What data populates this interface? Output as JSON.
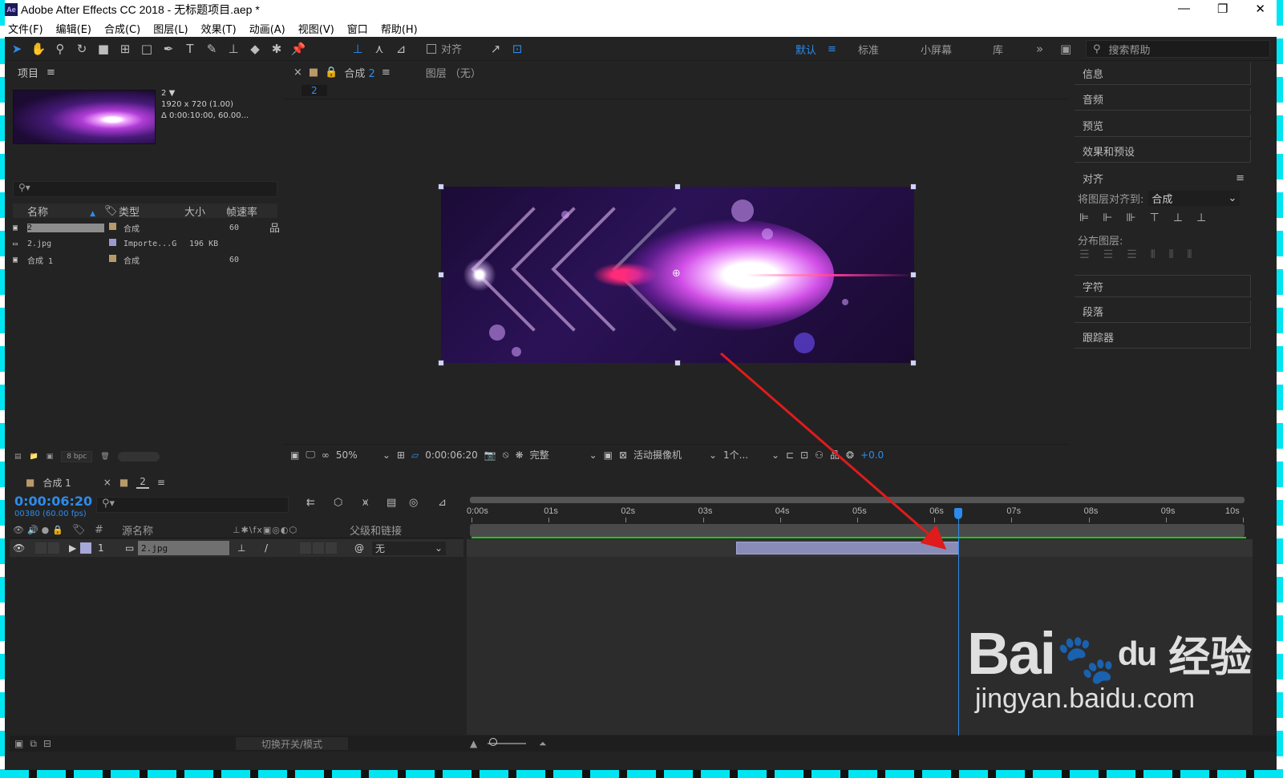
{
  "titlebar": {
    "title": "Adobe After Effects CC 2018 - 无标题项目.aep *",
    "icon": "Ae"
  },
  "menu": [
    "文件(F)",
    "编辑(E)",
    "合成(C)",
    "图层(L)",
    "效果(T)",
    "动画(A)",
    "视图(V)",
    "窗口",
    "帮助(H)"
  ],
  "toolbar": {
    "align_label": "对齐",
    "workspaces": [
      "默认",
      "标准",
      "小屏幕",
      "库"
    ],
    "active_workspace": "默认",
    "search_placeholder": "搜索帮助"
  },
  "project": {
    "tab": "项目",
    "selected": {
      "name": "2",
      "dims": "1920 x 720 (1.00)",
      "duration": "Δ 0:00:10:00, 60.00..."
    },
    "columns": [
      "名称",
      "类型",
      "大小",
      "帧速率"
    ],
    "items": [
      {
        "name": "2",
        "type": "合成",
        "size": "",
        "fps": "60",
        "color": "#b89a6a",
        "icon": "composition-icon"
      },
      {
        "name": "2.jpg",
        "type": "Importe...G",
        "size": "196 KB",
        "fps": "",
        "color": "#9a9ad0",
        "icon": "image-file-icon"
      },
      {
        "name": "合成 1",
        "type": "合成",
        "size": "",
        "fps": "60",
        "color": "#b89a6a",
        "icon": "composition-icon"
      }
    ],
    "bpc": "8 bpc"
  },
  "composition": {
    "tab_prefix": "合成",
    "tab_name": "2",
    "layer_tab": "图层 （无）",
    "breadcrumb": "2",
    "zoom": "50%",
    "timecode": "0:00:06:20",
    "resolution": "完整",
    "camera": "活动摄像机",
    "views": "1个...",
    "exposure": "+0.0"
  },
  "right_panels": {
    "items": [
      "信息",
      "音频",
      "预览",
      "效果和预设"
    ],
    "align_title": "对齐",
    "align_to_label": "将图层对齐到:",
    "align_to_value": "合成",
    "distribute_label": "分布图层:",
    "lower": [
      "字符",
      "段落",
      "跟踪器"
    ]
  },
  "timeline": {
    "tabs": [
      {
        "name": "合成 1",
        "active": false
      },
      {
        "name": "2",
        "active": true
      }
    ],
    "timecode": "0:00:06:20",
    "frames": "00380 (60.00 fps)",
    "columns": {
      "num": "#",
      "source": "源名称",
      "parent": "父级和链接"
    },
    "layer": {
      "index": "1",
      "name": "2.jpg",
      "parent": "无",
      "color": "#a7a7d8"
    },
    "ticks": [
      "0:00s",
      "01s",
      "02s",
      "03s",
      "04s",
      "05s",
      "06s",
      "07s",
      "08s",
      "09s",
      "10s"
    ],
    "footer_mode": "切换开关/模式"
  },
  "watermark": {
    "brand_a": "Bai",
    "brand_b": "du",
    "cn": "经验",
    "url": "jingyan.baidu.com"
  },
  "colors": {
    "accent": "#2d8ceb",
    "arrow": "#e01b1b",
    "clip": "#8a8cb8"
  }
}
